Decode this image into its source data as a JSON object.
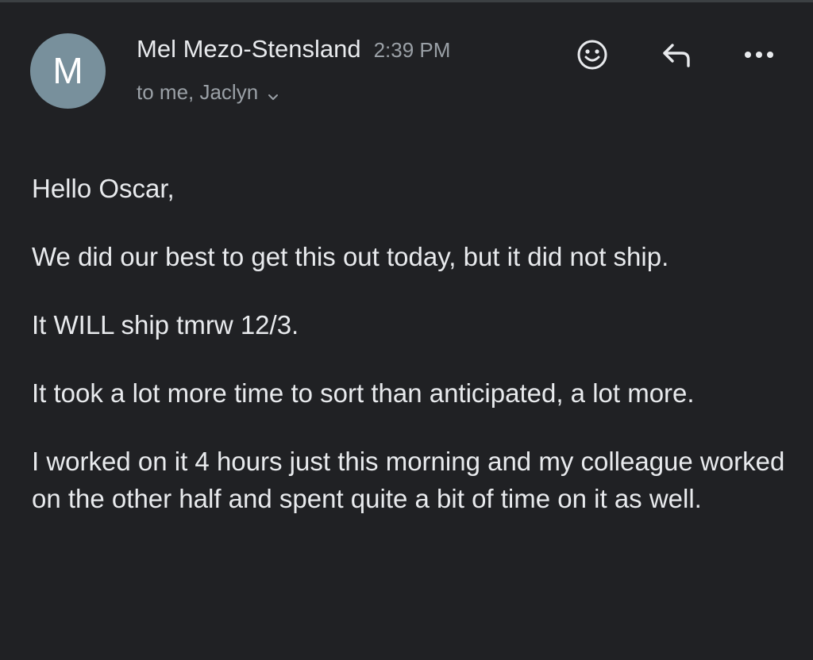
{
  "email": {
    "avatar_letter": "M",
    "sender_name": "Mel Mezo-Stensland",
    "time": "2:39 PM",
    "recipients": "to me, Jaclyn",
    "body_paragraphs": [
      "Hello Oscar,",
      "We did our best to get this out today, but it did not ship.",
      "It WILL ship tmrw 12/3.",
      "It took a lot more time to sort than anticipated, a lot more.",
      "I worked on it 4 hours just this morning and my colleague worked on the other half and spent quite a bit of time on it as well."
    ]
  },
  "icons": {
    "react": "smiley-icon",
    "reply": "reply-arrow-icon",
    "more": "more-vert-dots-icon",
    "expand": "chevron-down-icon"
  },
  "colors": {
    "background": "#202124",
    "avatar": "#78909c",
    "primary_text": "#e8eaed",
    "secondary_text": "#9aa0a6"
  }
}
